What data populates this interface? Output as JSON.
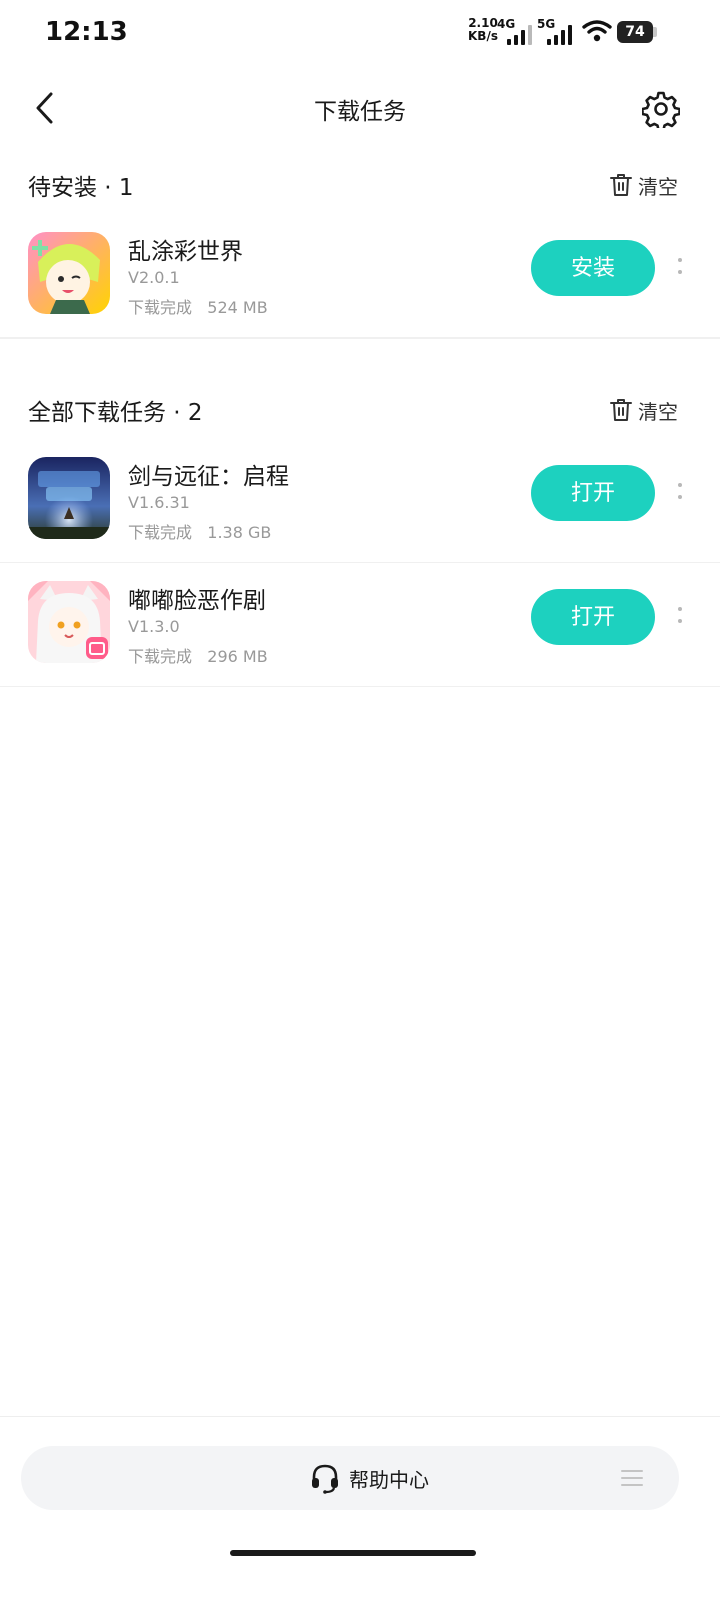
{
  "status_bar": {
    "time": "12:13",
    "net_speed_value": "2.10",
    "net_speed_unit": "KB/s",
    "signal_1_label": "4G",
    "signal_2_label": "5G",
    "battery": "74"
  },
  "header": {
    "title": "下载任务",
    "back_icon": "chevron-left-icon",
    "settings_icon": "gear-icon"
  },
  "sections": {
    "pending": {
      "title": "待安装 · 1",
      "clear_label": "清空",
      "items": [
        {
          "name": "乱涂彩世界",
          "version": "V2.0.1",
          "status": "下载完成   524 MB",
          "action": "安装"
        }
      ]
    },
    "all": {
      "title": "全部下载任务 · 2",
      "clear_label": "清空",
      "items": [
        {
          "name": "剑与远征：启程",
          "version": "V1.6.31",
          "status": "下载完成   1.38 GB",
          "action": "打开"
        },
        {
          "name": "嘟嘟脸恶作剧",
          "version": "V1.3.0",
          "status": "下载完成   296 MB",
          "action": "打开"
        }
      ]
    }
  },
  "bottom": {
    "help_label": "帮助中心",
    "help_icon": "headset-icon",
    "menu_icon": "menu-icon"
  },
  "colors": {
    "accent": "#1dd1bf",
    "secondary_text": "#999999",
    "help_bar_bg": "#f3f4f6"
  }
}
